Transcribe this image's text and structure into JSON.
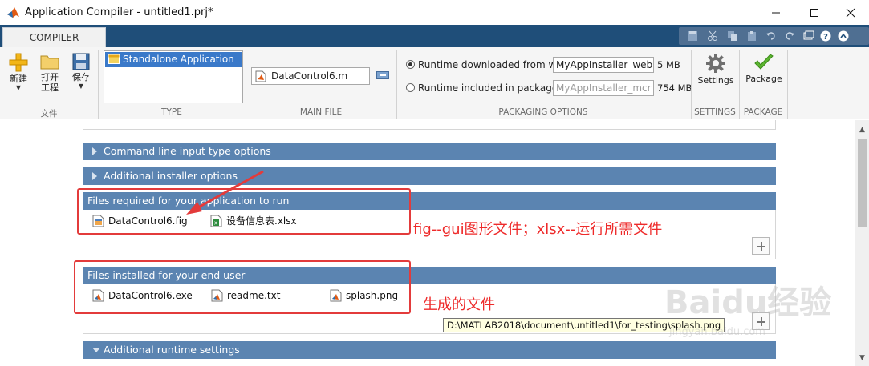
{
  "window": {
    "title": "Application Compiler - untitled1.prj*"
  },
  "tabs": {
    "compiler": "COMPILER"
  },
  "ribbon": {
    "file_group": {
      "label": "文件",
      "new": "新建",
      "open_line1": "打开",
      "open_line2": "工程",
      "save": "保存"
    },
    "type_group": {
      "label": "TYPE",
      "selected": "Standalone Application"
    },
    "main_file_group": {
      "label": "MAIN FILE",
      "file": "DataControl6.m"
    },
    "packaging_group": {
      "label": "PACKAGING OPTIONS",
      "option_web": "Runtime downloaded from web",
      "option_web_value": "MyAppInstaller_web",
      "option_web_size": "5 MB",
      "option_pkg": "Runtime included in package",
      "option_pkg_value": "MyAppInstaller_mcr",
      "option_pkg_size": "754 MB",
      "selected": "web"
    },
    "settings_group": {
      "label": "SETTINGS",
      "button": "Settings"
    },
    "package_group": {
      "label": "PACKAGE",
      "button": "Package"
    }
  },
  "sections": {
    "cmdline": "Command line input type options",
    "installer": "Additional installer options",
    "required": "Files required for your application to run",
    "installed": "Files installed for your end user",
    "runtime": "Additional runtime settings"
  },
  "required_files": [
    "DataControl6.fig",
    "设备信息表.xlsx"
  ],
  "installed_files": [
    "DataControl6.exe",
    "readme.txt",
    "splash.png"
  ],
  "tooltip": "D:\\MATLAB2018\\document\\untitled1\\for_testing\\splash.png",
  "annotations": {
    "required_note": "fig--gui图形文件；xlsx--运行所需文件",
    "installed_note": "生成的文件"
  },
  "watermark": {
    "brand": "Baidu经验",
    "url": "jingyan.baidu.com"
  },
  "colors": {
    "tab_strip": "#1f4e79",
    "section_bar": "#5b84b1",
    "annotation_red": "#e33b3b",
    "selection_blue": "#3a79c9"
  }
}
